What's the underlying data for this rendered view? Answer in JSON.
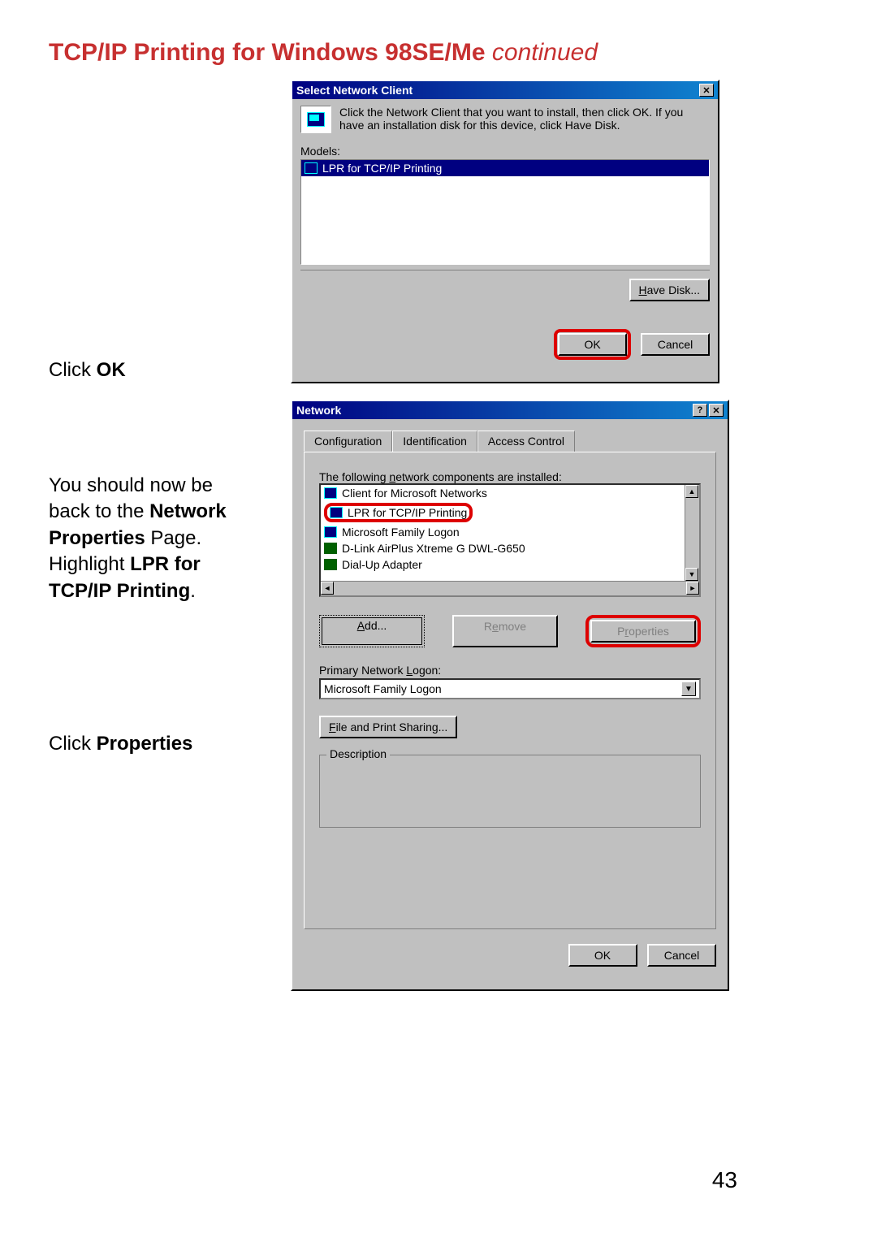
{
  "page": {
    "title_main": "TCP/IP Printing for Windows 98SE/Me ",
    "title_cont": "continued",
    "number": "43"
  },
  "instructions": {
    "click_ok_pre": "Click ",
    "click_ok_bold": "OK",
    "back1": "You should now be",
    "back2_pre": "back to the ",
    "back2_bold": "Network",
    "back3_bold": "Properties ",
    "back3_post": "Page.",
    "hl_pre": "Highlight ",
    "hl_bold": "LPR for",
    "hl_bold2": "TCP/IP Printing",
    "hl_post": ".",
    "click_props_pre": "Click ",
    "click_props_bold": "Properties"
  },
  "dialog1": {
    "title": "Select Network Client",
    "info_text": "Click the Network Client that you want to install, then click OK. If you have an installation disk for this device, click Have Disk.",
    "models_label": "Models:",
    "model_item": "LPR for TCP/IP Printing",
    "have_disk": "Have Disk...",
    "have_disk_access": "H",
    "ok": "OK",
    "cancel": "Cancel"
  },
  "dialog2": {
    "title": "Network",
    "tabs": [
      "Configuration",
      "Identification",
      "Access Control"
    ],
    "components_label": "The following network components are installed:",
    "components_access": "n",
    "components": [
      "Client for Microsoft Networks",
      "LPR for TCP/IP Printing",
      "Microsoft Family Logon",
      "D-Link AirPlus Xtreme G DWL-G650",
      "Dial-Up Adapter"
    ],
    "add": "Add...",
    "add_access": "A",
    "remove": "Remove",
    "remove_access": "R",
    "properties": "Properties",
    "properties_access": "r",
    "primary_logon_label": "Primary Network Logon:",
    "primary_logon_access": "L",
    "primary_logon_value": "Microsoft Family Logon",
    "file_print": "File and Print Sharing...",
    "file_print_access": "F",
    "description_label": "Description",
    "ok": "OK",
    "cancel": "Cancel"
  }
}
